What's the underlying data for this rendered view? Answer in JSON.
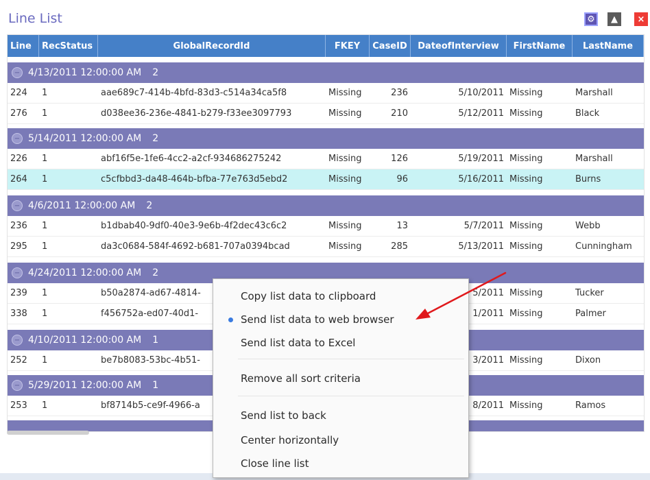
{
  "window": {
    "title": "Line List"
  },
  "titlebar_buttons": {
    "settings_icon": "gear-icon",
    "back_icon": "triangle-up-icon",
    "close_icon": "close-icon",
    "close_label": "×"
  },
  "columns": [
    "Line",
    "RecStatus",
    "GlobalRecordId",
    "FKEY",
    "CaseID",
    "DateofInterview",
    "FirstName",
    "LastName"
  ],
  "groups": [
    {
      "label": "4/13/2011 12:00:00 AM",
      "count": "2",
      "rows": [
        [
          "224",
          "1",
          "aae689c7-414b-4bfd-83d3-c514a34ca5f8",
          "Missing",
          "236",
          "5/10/2011",
          "Missing",
          "Marshall"
        ],
        [
          "276",
          "1",
          "d038ee36-236e-4841-b279-f33ee3097793",
          "Missing",
          "210",
          "5/12/2011",
          "Missing",
          "Black"
        ]
      ]
    },
    {
      "label": "5/14/2011 12:00:00 AM",
      "count": "2",
      "rows": [
        [
          "226",
          "1",
          "abf16f5e-1fe6-4cc2-a2cf-934686275242",
          "Missing",
          "126",
          "5/19/2011",
          "Missing",
          "Marshall"
        ],
        [
          "264",
          "1",
          "c5cfbbd3-da48-464b-bfba-77e763d5ebd2",
          "Missing",
          "96",
          "5/16/2011",
          "Missing",
          "Burns"
        ]
      ]
    },
    {
      "label": "4/6/2011 12:00:00 AM",
      "count": "2",
      "rows": [
        [
          "236",
          "1",
          "b1dbab40-9df0-40e3-9e6b-4f2dec43c6c2",
          "Missing",
          "13",
          "5/7/2011",
          "Missing",
          "Webb"
        ],
        [
          "295",
          "1",
          "da3c0684-584f-4692-b681-707a0394bcad",
          "Missing",
          "285",
          "5/13/2011",
          "Missing",
          "Cunningham"
        ]
      ]
    },
    {
      "label": "4/24/2011 12:00:00 AM",
      "count": "2",
      "rows": [
        [
          "239",
          "1",
          "b50a2874-ad67-4814-",
          "",
          "",
          "5/2011",
          "Missing",
          "Tucker"
        ],
        [
          "338",
          "1",
          "f456752a-ed07-40d1-",
          "",
          "",
          "1/2011",
          "Missing",
          "Palmer"
        ]
      ]
    },
    {
      "label": "4/10/2011 12:00:00 AM",
      "count": "1",
      "rows": [
        [
          "252",
          "1",
          "be7b8083-53bc-4b51-",
          "",
          "",
          "3/2011",
          "Missing",
          "Dixon"
        ]
      ]
    },
    {
      "label": "5/29/2011 12:00:00 AM",
      "count": "1",
      "rows": [
        [
          "253",
          "1",
          "bf8714b5-ce9f-4966-a",
          "",
          "",
          "8/2011",
          "Missing",
          "Ramos"
        ]
      ]
    }
  ],
  "context_menu": {
    "items": [
      "Copy list data to clipboard",
      "Send list data to web browser",
      "Send list data to Excel",
      "Remove all sort criteria",
      "Send list to back",
      "Center horizontally",
      "Close line list"
    ]
  },
  "colors": {
    "header": "#4580c8",
    "group": "#7a7ab7",
    "selected_row": "#c9f3f5",
    "annotation_arrow": "#e0191c"
  }
}
